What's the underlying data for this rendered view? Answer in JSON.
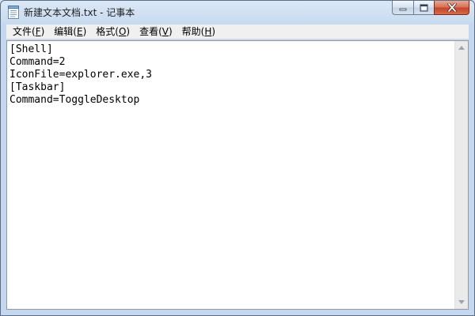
{
  "window": {
    "title": "新建文本文档.txt - 记事本",
    "icon": "notepad-icon"
  },
  "caption_buttons": {
    "minimize_icon": "minimize-icon",
    "maximize_icon": "maximize-icon",
    "close_icon": "close-icon"
  },
  "menu": {
    "items": [
      {
        "text": "文件(",
        "accel": "F",
        "close": ")"
      },
      {
        "text": "编辑(",
        "accel": "E",
        "close": ")"
      },
      {
        "text": "格式(",
        "accel": "O",
        "close": ")"
      },
      {
        "text": "查看(",
        "accel": "V",
        "close": ")"
      },
      {
        "text": "帮助(",
        "accel": "H",
        "close": ")"
      }
    ]
  },
  "editor": {
    "content": "[Shell]\nCommand=2\nIconFile=explorer.exe,3\n[Taskbar]\nCommand=ToggleDesktop"
  },
  "colors": {
    "title_bar": "#c9dbef",
    "close_button": "#c4462c",
    "menu_bg": "#f0f0f0",
    "editor_bg": "#ffffff"
  }
}
